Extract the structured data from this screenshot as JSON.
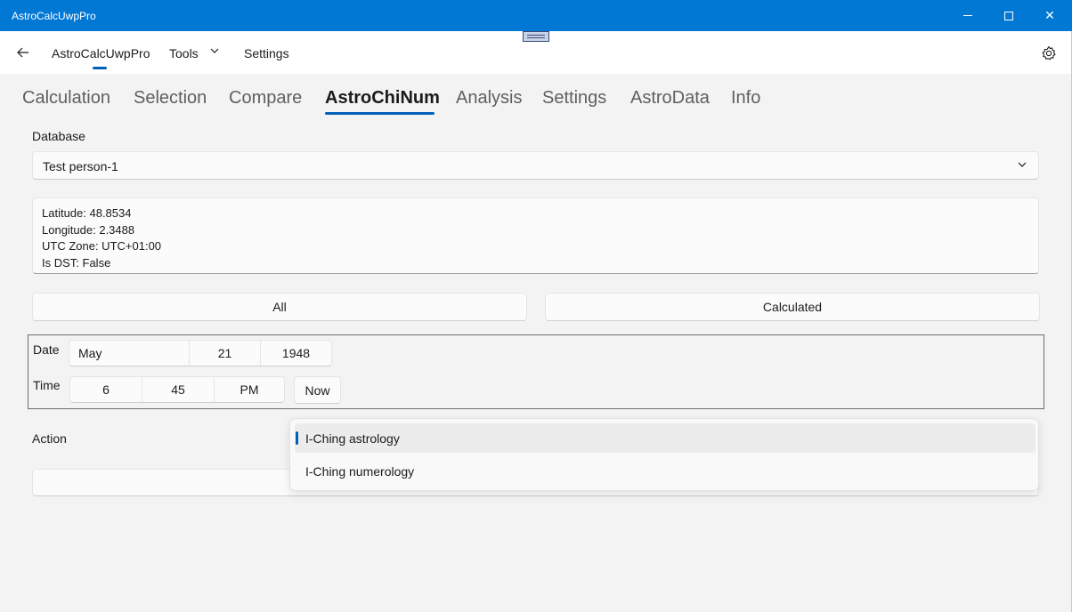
{
  "window": {
    "title": "AstroCalcUwpPro",
    "accent": "#0078d4",
    "minimize_icon": "minimize-icon",
    "maximize_icon": "maximize-icon",
    "close_glyph": "✕"
  },
  "navbar": {
    "back_icon": "back-arrow-icon",
    "items": [
      {
        "label": "AstroCalcUwpPro",
        "selected": true
      },
      {
        "label": "Tools",
        "has_dropdown": true
      },
      {
        "label": "Settings"
      }
    ],
    "settings_icon": "gear-icon"
  },
  "tabs": {
    "items": [
      {
        "label": "Calculation"
      },
      {
        "label": "Selection"
      },
      {
        "label": "Compare"
      },
      {
        "label": "AstroChiNum",
        "active": true
      },
      {
        "label": "Analysis"
      },
      {
        "label": "Settings"
      },
      {
        "label": "AstroData"
      },
      {
        "label": "Info"
      }
    ]
  },
  "database": {
    "label": "Database",
    "selected": "Test person-1"
  },
  "info": {
    "lines": [
      "Latitude: 48.8534",
      "Longitude: 2.3488",
      "UTC Zone: UTC+01:00",
      "Is DST: False"
    ]
  },
  "buttons": {
    "all": "All",
    "calculated": "Calculated"
  },
  "datetime": {
    "date_label": "Date",
    "time_label": "Time",
    "month": "May",
    "day": "21",
    "year": "1948",
    "hour": "6",
    "minute": "45",
    "period": "PM",
    "now_label": "Now"
  },
  "action": {
    "label": "Action",
    "options": [
      "I-Ching astrology",
      "I-Ching numerology"
    ],
    "selected_index": 0
  }
}
